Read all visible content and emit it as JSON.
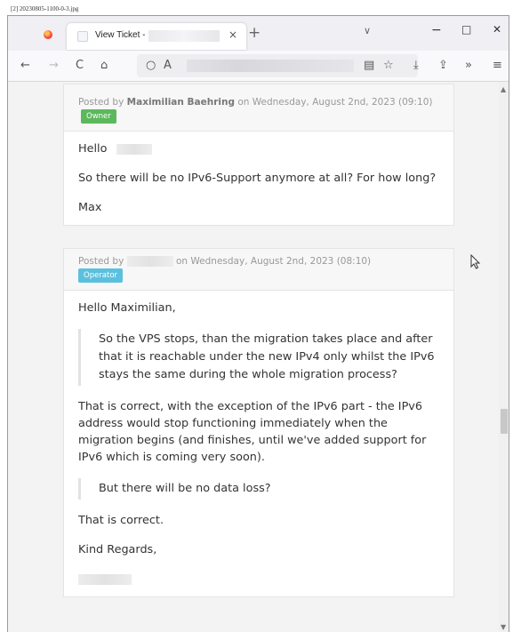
{
  "filename": "[2] 20230805-1100-0-3.jpg",
  "browser": {
    "tab_title": "View Ticket -",
    "tab_close": "×",
    "new_tab": "+",
    "tab_list": "∨",
    "minimize": "−",
    "maximize": "□",
    "close": "✕",
    "icons": {
      "back": "←",
      "forward": "→",
      "reload": "C",
      "home": "⌂",
      "tracking": "○",
      "lock": "A",
      "reader": "▤",
      "star": "☆",
      "download": "⤓",
      "share": "⇪",
      "overflow": "»",
      "menu": "≡"
    },
    "accent_color": "#ff7139"
  },
  "ticket": {
    "reply1": {
      "posted_prefix": "Posted by",
      "author": "Maximilian Baehring",
      "date_text": "on Wednesday, August 2nd, 2023 (09:10)",
      "badge": "Owner",
      "greeting": "Hello",
      "question": "So there will be no IPv6-Support anymore at all? For how long?",
      "signature": "Max"
    },
    "reply2": {
      "posted_prefix": "Posted by",
      "date_text": "on Wednesday, August 2nd, 2023 (08:10)",
      "badge": "Operator",
      "greeting": "Hello Maximilian,",
      "quote1": "So the VPS stops, than the migration takes place and after that it is reachable under the new IPv4 only whilst the IPv6 stays the same during the whole migration process?",
      "answer1": "That is correct, with the exception of the IPv6 part - the IPv6 address would stop functioning immediately when the migration begins (and finishes, until we've added support for IPv6 which is coming very soon).",
      "quote2": "But there will be no data loss?",
      "answer2": "That is correct.",
      "closing": "Kind Regards,"
    }
  },
  "colors": {
    "owner_badge": "#5cb85c",
    "operator_badge": "#5bc0de"
  }
}
